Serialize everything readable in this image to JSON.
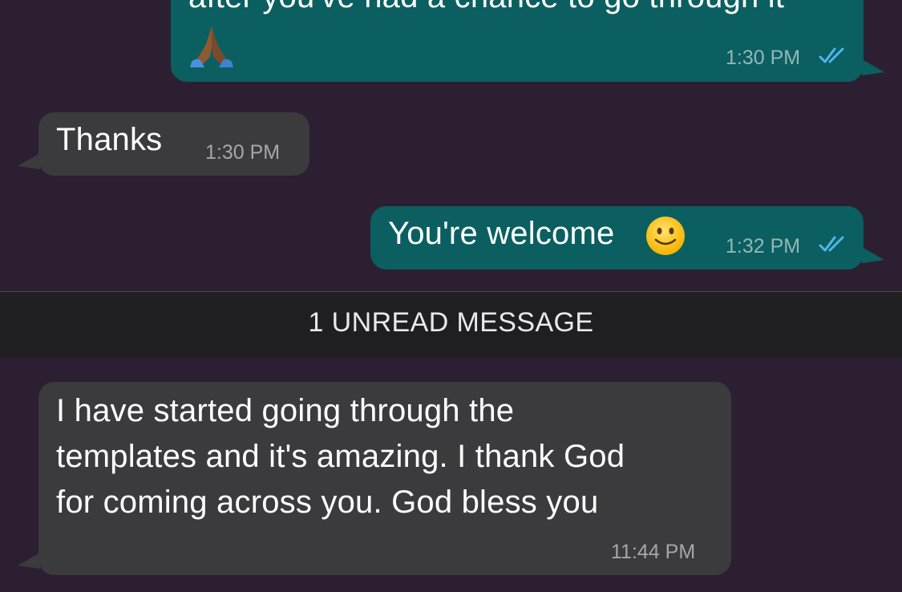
{
  "messages": [
    {
      "direction": "outgoing",
      "text": "after you've had a chance to go through it",
      "time": "1:30 PM",
      "status": "read",
      "emoji": "folded-hands"
    },
    {
      "direction": "incoming",
      "text": "Thanks",
      "time": "1:30 PM"
    },
    {
      "direction": "outgoing",
      "text": "You're welcome",
      "time": "1:32 PM",
      "status": "read",
      "emoji": "slightly-smiling-face"
    },
    {
      "direction": "incoming",
      "lines": [
        "I have started going through the",
        "templates and it's amazing. I thank God",
        "for coming across you. God bless you"
      ],
      "time": "11:44 PM"
    }
  ],
  "unread_divider": {
    "label": "1 UNREAD MESSAGE"
  },
  "colors": {
    "background": "#2c1f32",
    "outgoing_bubble": "#0b5f60",
    "incoming_bubble": "#3b3b3d",
    "read_ticks": "#4fb6ec",
    "divider_bg": "#1f1f21"
  }
}
